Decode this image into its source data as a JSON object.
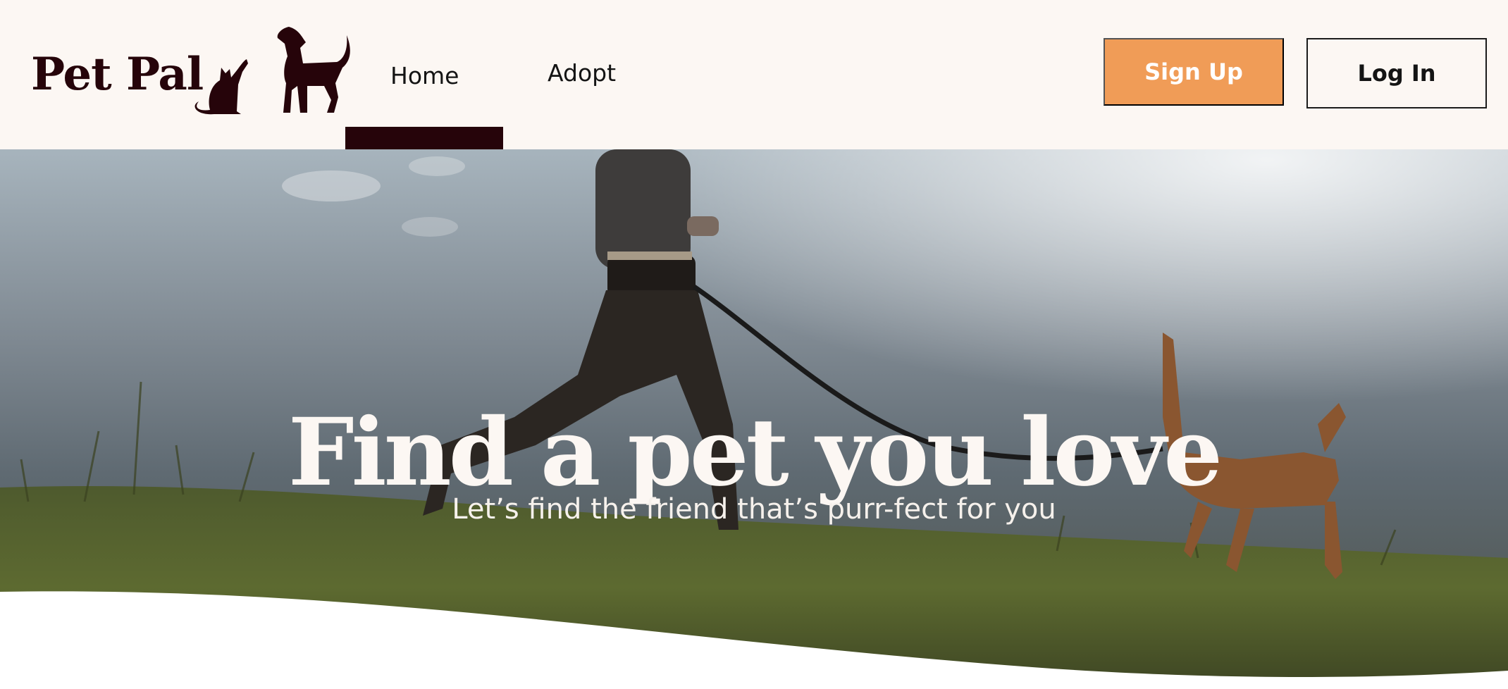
{
  "brand": {
    "name": "Pet Pal",
    "logo_icon": "cat-and-dog-silhouette-icon"
  },
  "nav": {
    "links": [
      {
        "label": "Home",
        "active": true
      },
      {
        "label": "Adopt",
        "active": false
      }
    ]
  },
  "auth": {
    "signup_label": "Sign Up",
    "login_label": "Log In"
  },
  "hero": {
    "title": "Find a pet you love",
    "subtitle": "Let’s find the friend that’s purr-fect for you"
  },
  "colors": {
    "nav_background": "#fcf7f3",
    "brand_dark": "#26040a",
    "signup_orange": "#f09c57",
    "hero_text": "#fcf7f3"
  }
}
